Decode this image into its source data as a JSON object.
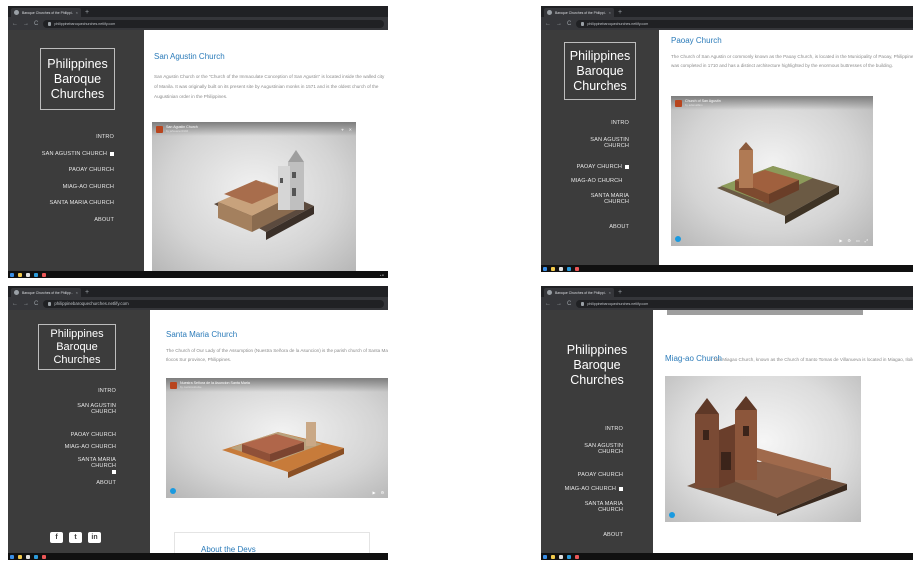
{
  "colors": {
    "sidebar_bg": "#3c3c3c",
    "heading": "#2b7bb9",
    "body_text": "#8a8a8a",
    "chrome_bg": "#202124",
    "viewer_brand": "#1a9ae0"
  },
  "site": {
    "logo_lines": [
      "Philippines",
      "Baroque",
      "Churches"
    ],
    "menu": {
      "intro": "INTRO",
      "san_agustin": "SAN AGUSTIN CHURCH",
      "san_agustin_l1": "SAN AGUSTIN",
      "san_agustin_l2": "CHURCH",
      "paoay": "PAOAY CHURCH",
      "miagao": "MIAG-AO CHURCH",
      "santa_maria": "SANTA MARIA CHURCH",
      "santa_maria_l1": "SANTA MARIA",
      "santa_maria_l2": "CHURCH",
      "about": "ABOUT"
    },
    "social": [
      "f",
      "t",
      "in"
    ]
  },
  "browser": {
    "tab_title_1": "Baroque Churches of the Philippi...",
    "tab_title_2": "Baroque Churches of the Philipp...",
    "tab_close": "×",
    "tab_new": "+",
    "back": "←",
    "forward": "→",
    "reload": "C",
    "url_1": "philippinebaroquechurches.netlify.com",
    "url_2": "philippinebaroquechurches.netlify.com"
  },
  "panels": {
    "p1": {
      "heading": "San Agustin Church",
      "paragraph": "San Agustin Church or the \"Church of the Immaculate Conception of San Agustin\" is located inside the walled city of Manila. It was originally built on its present site by Augustinian monks in 1571 and is the oldest church of the Augustinian order in the Philippines.",
      "viewer_title": "San Agustin Church",
      "viewer_sub": "by jahsuarez1994"
    },
    "p2": {
      "heading": "Paoay Church",
      "paragraph": "The Church of San Agustin or commonly known as the Paoay Church, is located in the Municipality of Paoay, Philippines. It was completed in 1710 and has a distinct architecture highlighted by the enormous buttresses of the building.",
      "viewer_title": "Church of San Agustin",
      "viewer_sub": "by adamalfaro"
    },
    "p3": {
      "heading": "Santa Maria Church",
      "paragraph": "The Church of Our Lady of the Assumption (Nuestra Señora de la Asuncion) is the parish church of Santa Maria in Ilocos Sur province, Philippines.",
      "viewer_title": "Nuestra Señora de la Asuncion Santa Maria",
      "viewer_sub": "by coolsimsburke",
      "about_title": "About the Devs"
    },
    "p4": {
      "heading": "Miag-ao Church",
      "paragraph": "The Miagao Church, known as the Church of Santo Tomas de Villanueva is located in Miagao, Iloilo"
    }
  },
  "viewer_controls": {
    "icons": [
      "⌖",
      "✕"
    ],
    "play": "▶",
    "settings": "⚙",
    "vr": "▭",
    "fullscreen": "⤢"
  },
  "taskbar": {
    "time": "▴ ■"
  }
}
